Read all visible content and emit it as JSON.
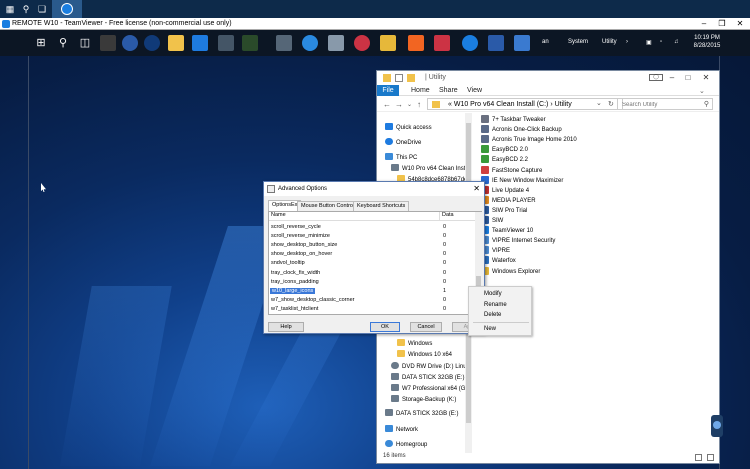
{
  "teamviewer": {
    "title": "REMOTE W10 - TeamViewer - Free license (non-commercial use only)",
    "minimize": "–",
    "restore": "❒",
    "close": "✕"
  },
  "taskbar": {
    "tray_items": [
      "an",
      "System",
      "Utility"
    ],
    "time": "10:19 PM",
    "date": "8/28/2015"
  },
  "explorer": {
    "title_path": "| Utility",
    "ribbon_tabs": [
      "File",
      "Home",
      "Share",
      "View"
    ],
    "breadcrumb": "«  W10 Pro v64 Clean Install (C:)  ›  Utility",
    "search_placeholder": "Search Utility",
    "nav_items": [
      {
        "label": "Quick access",
        "icon": "star-icon",
        "color": "#1e7be0"
      },
      {
        "label": "OneDrive",
        "icon": "cloud-icon",
        "color": "#1e7be0"
      },
      {
        "label": "This PC",
        "icon": "computer-icon",
        "color": "#3a8ad8"
      },
      {
        "label": "W10 Pro v64 Clean Instal",
        "icon": "drive-icon",
        "color": "#6a7a8a"
      },
      {
        "label": "54b8c8dce6878b67ded",
        "icon": "folder-icon",
        "color": "#f1c24b"
      },
      {
        "label": "Windows",
        "icon": "folder-icon",
        "color": "#f1c24b"
      },
      {
        "label": "Windows 10 x64",
        "icon": "folder-icon",
        "color": "#f1c24b"
      },
      {
        "label": "DVD RW Drive (D:) Linux",
        "icon": "dvd-icon",
        "color": "#6a7a8a"
      },
      {
        "label": "DATA STICK 32GB (E:)",
        "icon": "usb-drive-icon",
        "color": "#6a7a8a"
      },
      {
        "label": "W7 Professional x64 (G:)",
        "icon": "drive-icon",
        "color": "#6a7a8a"
      },
      {
        "label": "Storage-Backup (K:)",
        "icon": "drive-icon",
        "color": "#6a7a8a"
      },
      {
        "label": "DATA STICK 32GB (E:)",
        "icon": "usb-drive-icon",
        "color": "#6a7a8a"
      },
      {
        "label": "Network",
        "icon": "network-icon",
        "color": "#3a8ad8"
      },
      {
        "label": "Homegroup",
        "icon": "homegroup-icon",
        "color": "#3a8ad8"
      }
    ],
    "files": [
      {
        "label": "7+ Taskbar Tweaker",
        "color": "#6a7080"
      },
      {
        "label": "Acronis One-Click Backup",
        "color": "#5a6a88"
      },
      {
        "label": "Acronis True Image Home 2010",
        "color": "#5a6a88"
      },
      {
        "label": "EasyBCD 2.0",
        "color": "#3a9a3a"
      },
      {
        "label": "EasyBCD 2.2",
        "color": "#3a9a3a"
      },
      {
        "label": "FastStone Capture",
        "color": "#d04040"
      },
      {
        "label": "IE New Window Maximizer",
        "color": "#2a6ad0"
      },
      {
        "label": "Live Update 4",
        "color": "#c03030"
      },
      {
        "label": "MEDIA PLAYER",
        "color": "#e08a20"
      },
      {
        "label": "SIW Pro Trial",
        "color": "#2a5aa0"
      },
      {
        "label": "SIW",
        "color": "#2a5aa0"
      },
      {
        "label": "TeamViewer 10",
        "color": "#1a7ee0"
      },
      {
        "label": "VIPRE Internet Security",
        "color": "#4a8ad0"
      },
      {
        "label": "VIPRE",
        "color": "#4a8ad0"
      },
      {
        "label": "Waterfox",
        "color": "#2a70c0"
      },
      {
        "label": "Windows Explorer",
        "color": "#e6b83a"
      }
    ],
    "status": "16 items"
  },
  "dialog": {
    "title": "Advanced Options",
    "close": "✕",
    "tabs": [
      "OptionsEx",
      "Mouse Button Control",
      "Keyboard Shortcuts"
    ],
    "columns": [
      "Name",
      "Data"
    ],
    "rows": [
      {
        "name": "scroll_reverse_cycle",
        "data": "0"
      },
      {
        "name": "scroll_reverse_minimize",
        "data": "0"
      },
      {
        "name": "show_desktop_button_size",
        "data": "0"
      },
      {
        "name": "show_desktop_on_hover",
        "data": "0"
      },
      {
        "name": "sndvol_tooltip",
        "data": "0"
      },
      {
        "name": "tray_clock_fix_width",
        "data": "0"
      },
      {
        "name": "tray_icons_padding",
        "data": "0"
      },
      {
        "name": "w10_large_icons",
        "data": "1"
      },
      {
        "name": "w7_show_desktop_classic_corner",
        "data": "0"
      },
      {
        "name": "w7_tasklist_htclient",
        "data": "0"
      }
    ],
    "buttons": {
      "help": "Help",
      "ok": "OK",
      "cancel": "Cancel",
      "apply": "Ap"
    }
  },
  "context_menu": [
    "Modify",
    "Rename",
    "Delete",
    "New"
  ]
}
